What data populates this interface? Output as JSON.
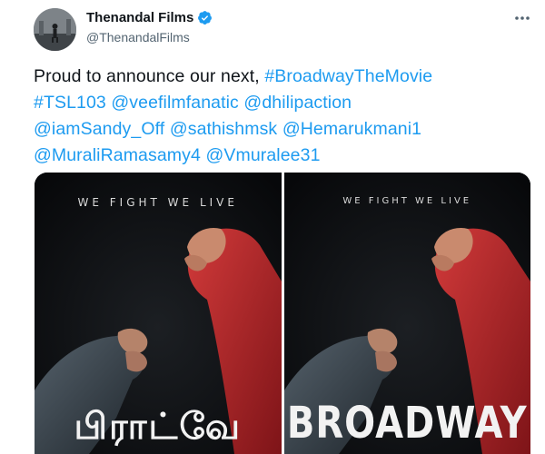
{
  "tweet": {
    "author": {
      "display_name": "Thenandal Films",
      "handle": "@ThenandalFilms",
      "verified": true
    },
    "text_lines": [
      [
        {
          "text": "Proud to announce  our next, ",
          "link": false
        },
        {
          "text": "#BroadwayTheMovie",
          "link": true
        }
      ],
      [
        {
          "text": "#TSL103",
          "link": true
        },
        {
          "text": " ",
          "link": false
        },
        {
          "text": "@veefilmfanatic",
          "link": true
        },
        {
          "text": " ",
          "link": false
        },
        {
          "text": "@dhilipaction",
          "link": true
        }
      ],
      [
        {
          "text": "@iamSandy_Off",
          "link": true
        },
        {
          "text": " ",
          "link": false
        },
        {
          "text": "@sathishmsk",
          "link": true
        },
        {
          "text": " ",
          "link": false
        },
        {
          "text": "@Hemarukmani1",
          "link": true
        }
      ],
      [
        {
          "text": "@MuraliRamasamy4",
          "link": true
        },
        {
          "text": " ",
          "link": false
        },
        {
          "text": "@Vmuralee31",
          "link": true
        }
      ]
    ],
    "media": [
      {
        "tagline": "WE FIGHT WE LIVE",
        "title": "பிராட்வே"
      },
      {
        "tagline": "WE FIGHT WE LIVE",
        "title": "BROADWAY"
      }
    ]
  },
  "icons": {
    "verified": "verified-badge-icon",
    "more": "more-options-icon"
  },
  "colors": {
    "link": "#1d9bf0",
    "text": "#0f1419",
    "secondary": "#536471",
    "verified": "#1d9bf0",
    "glove_red": "#b3262b",
    "glove_dark": "#3b4650",
    "poster_bg": "#0c0d0f"
  }
}
